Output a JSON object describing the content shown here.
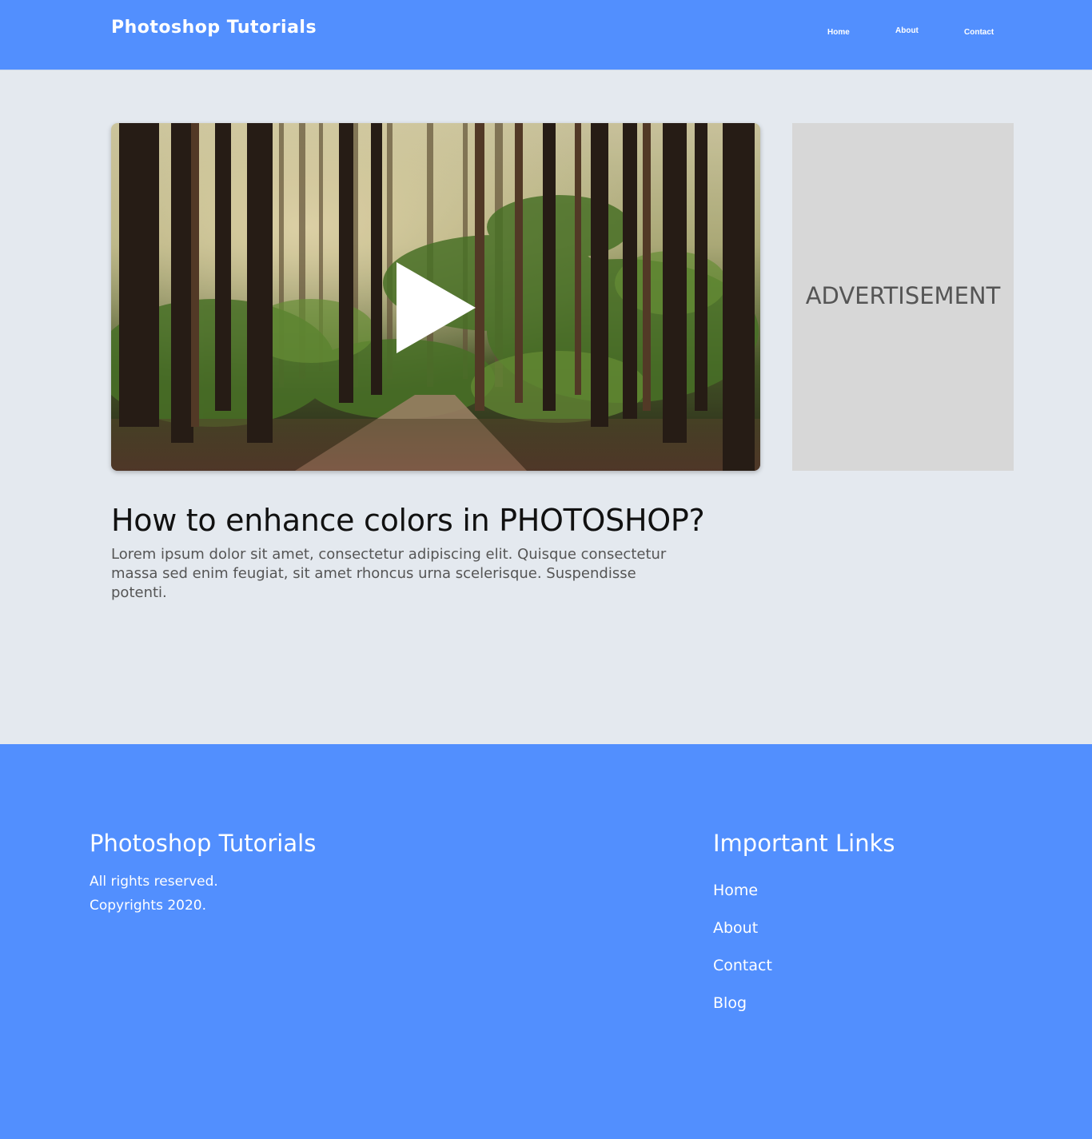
{
  "header": {
    "brand": "Photoshop Tutorials",
    "nav": {
      "home": "Home",
      "about": "About",
      "contact": "Contact"
    }
  },
  "main": {
    "video": {
      "thumbnail": "forest-path-image",
      "icon": "play-icon"
    },
    "advertisement": "ADVERTISEMENT",
    "title": "How to enhance colors in PHOTOSHOP?",
    "description": "Lorem ipsum dolor sit amet, consectetur adipiscing elit. Quisque consectetur massa sed enim feugiat, sit amet rhoncus urna scelerisque. Suspendisse potenti."
  },
  "footer": {
    "brand": "Photoshop Tutorials",
    "rights": "All rights reserved.",
    "copyright": "Copyrights 2020.",
    "links_title": "Important Links",
    "links": [
      "Home",
      "About",
      "Contact",
      "Blog"
    ]
  },
  "colors": {
    "primary": "#528ffe",
    "background": "#e4e9ef",
    "ad_background": "#d7d7d7"
  }
}
